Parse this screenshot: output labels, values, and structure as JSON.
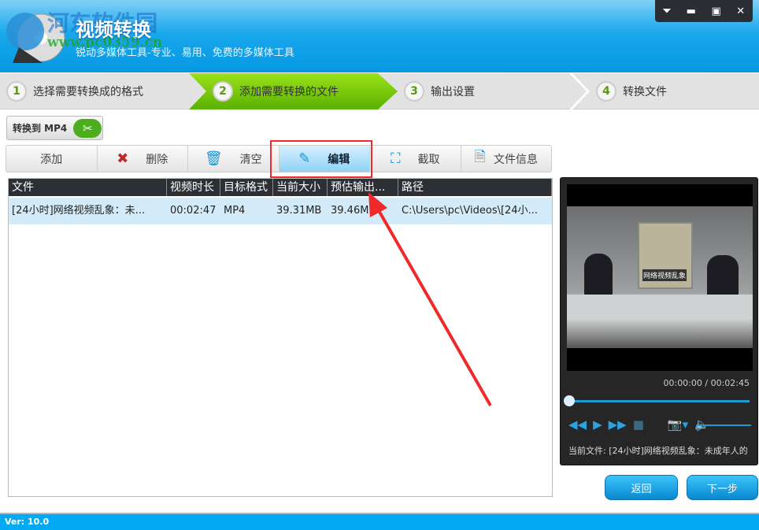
{
  "app": {
    "title": "视频转换",
    "subtitle": "锐动多媒体工具-专业、易用、免费的多媒体工具",
    "watermark": "河东软件园",
    "watermark_url": "www.pc0359.cn",
    "version": "Ver: 10.0"
  },
  "window_buttons": [
    "⏷",
    "▬",
    "▣",
    "✕"
  ],
  "steps": [
    {
      "num": "1",
      "label": "选择需要转换成的格式"
    },
    {
      "num": "2",
      "label": "添加需要转换的文件"
    },
    {
      "num": "3",
      "label": "输出设置"
    },
    {
      "num": "4",
      "label": "转换文件"
    }
  ],
  "format_button": "转换到 MP4",
  "toolbar": [
    {
      "label": "添加",
      "icon": ""
    },
    {
      "label": "删除",
      "icon": "✖"
    },
    {
      "label": "清空",
      "icon": "🗑"
    },
    {
      "label": "编辑",
      "icon": "✎"
    },
    {
      "label": "截取",
      "icon": "⛶"
    },
    {
      "label": "文件信息",
      "icon": "🗎"
    }
  ],
  "table": {
    "columns": [
      "文件",
      "视频时长",
      "目标格式",
      "当前大小",
      "预估输出...",
      "路径"
    ],
    "rows": [
      [
        "[24小时]网络视频乱象：未...",
        "00:02:47",
        "MP4",
        "39.31MB",
        "39.46MB",
        "C:\\Users\\pc\\Videos\\[24小..."
      ]
    ]
  },
  "player": {
    "timecode": "00:00:00 / 00:02:45",
    "current_file": "当前文件: [24小时]网络视频乱象：未成年人的",
    "caption": "网络视频乱象",
    "progress": 0
  },
  "buttons": {
    "back": "返回",
    "next": "下一步"
  },
  "colors": {
    "accent": "#1aa8ec",
    "step_active": "#7ccc0c",
    "highlight": "#f02a2a"
  }
}
